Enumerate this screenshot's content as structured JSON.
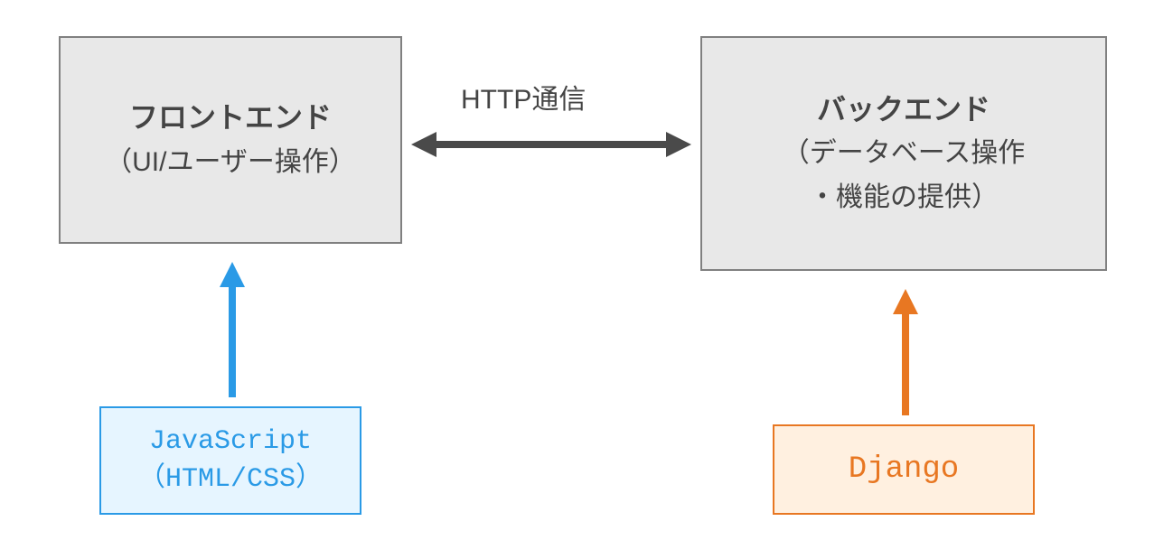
{
  "frontend": {
    "title": "フロントエンド",
    "subtitle": "（UI/ユーザー操作）"
  },
  "backend": {
    "title": "バックエンド",
    "subtitle1": "（データベース操作",
    "subtitle2": "・機能の提供）"
  },
  "connection": {
    "label": "HTTP通信"
  },
  "js": {
    "line1": "JavaScript",
    "line2": "（HTML/CSS）"
  },
  "django": {
    "label": "Django"
  },
  "colors": {
    "gray_box_bg": "#e8e8e8",
    "gray_box_border": "#808080",
    "blue_box_bg": "#e6f5ff",
    "blue": "#2a9ae6",
    "orange_box_bg": "#fff0e0",
    "orange": "#e87722",
    "text_dark": "#444444",
    "arrow_dark": "#4a4a4a"
  }
}
